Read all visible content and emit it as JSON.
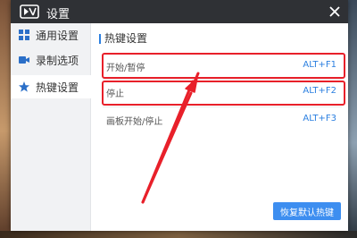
{
  "window": {
    "title": "设置",
    "close_icon": "close-icon",
    "logo_icon": "screen-recorder-logo-icon"
  },
  "sidebar": {
    "items": [
      {
        "label": "通用设置",
        "icon": "grid-icon",
        "active": false
      },
      {
        "label": "录制选项",
        "icon": "video-camera-icon",
        "active": false
      },
      {
        "label": "热键设置",
        "icon": "star-icon",
        "active": true
      }
    ]
  },
  "content": {
    "section_title": "热键设置",
    "hotkeys": [
      {
        "name": "开始/暂停",
        "key": "ALT+F1"
      },
      {
        "name": "停止",
        "key": "ALT+F2"
      },
      {
        "name": "画板开始/停止",
        "key": "ALT+F3"
      }
    ],
    "restore_button_label": "恢复默认热键"
  },
  "colors": {
    "titlebar": "#2f3135",
    "accent": "#2b7fe0",
    "annotation": "#e8202a"
  }
}
